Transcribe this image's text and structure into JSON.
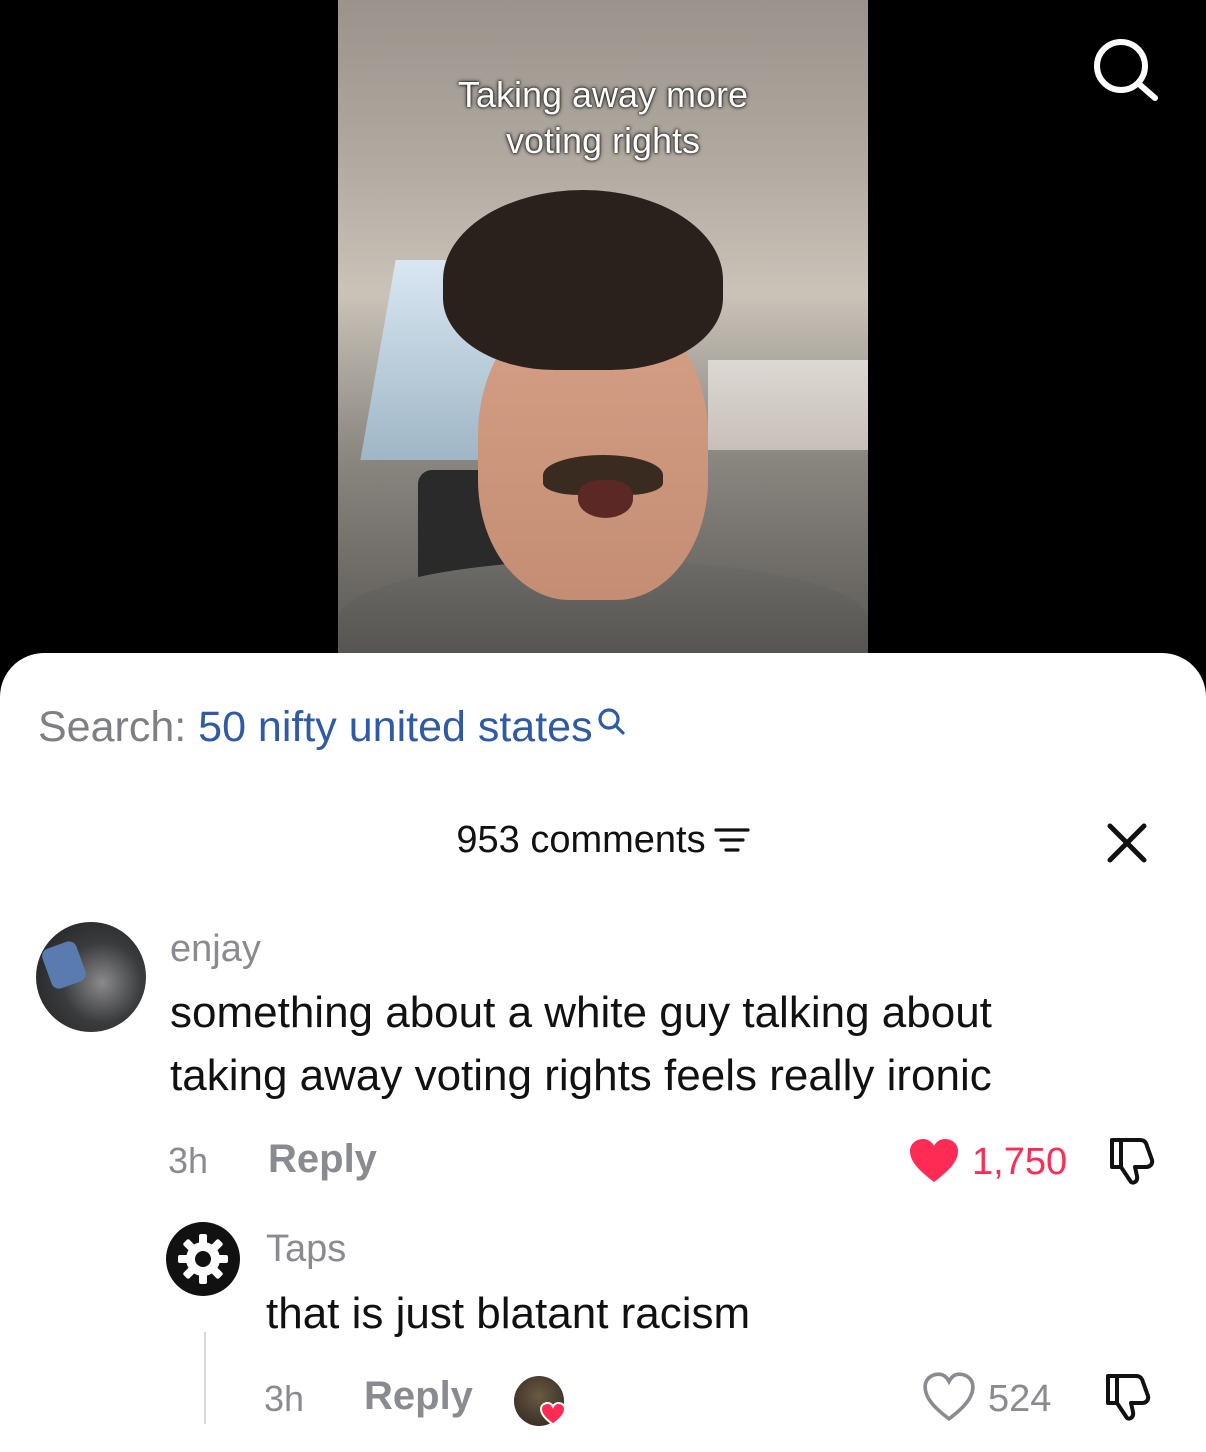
{
  "video": {
    "caption_line1": "Taking away more",
    "caption_line2": "voting rights"
  },
  "search_suggestion": {
    "prefix": "Search:",
    "term": "50 nifty united states"
  },
  "comments_panel": {
    "count_label": "953 comments"
  },
  "comments": [
    {
      "username": "enjay",
      "text_line1": "something about a white guy talking about",
      "text_line2": "taking away voting rights feels really ironic",
      "time": "3h",
      "reply_label": "Reply",
      "likes": "1,750",
      "liked": true
    },
    {
      "username": "Taps",
      "text": "that is just blatant racism",
      "time": "3h",
      "reply_label": "Reply",
      "likes": "524",
      "liked": false,
      "creator_liked": true
    }
  ],
  "colors": {
    "like_red": "#fe2c55",
    "search_blue": "#2e5aa6",
    "muted_gray": "#8a8b90"
  }
}
